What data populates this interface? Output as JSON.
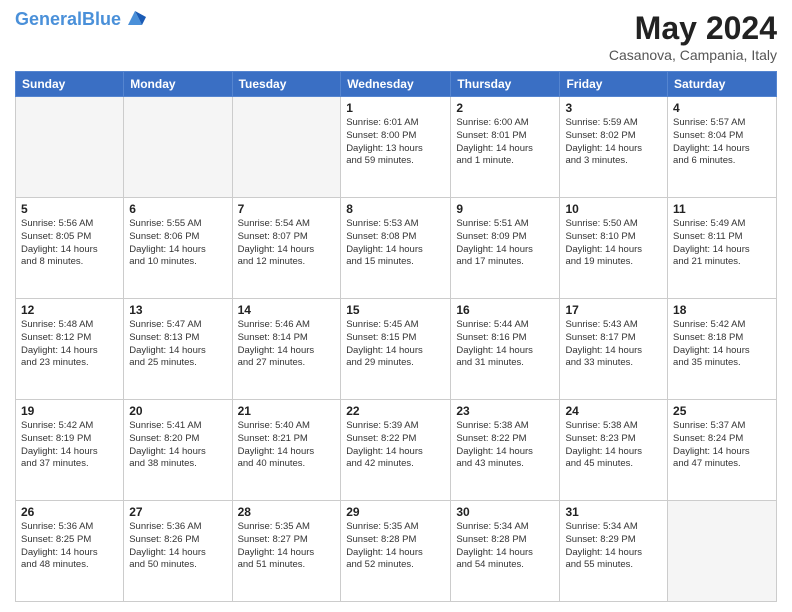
{
  "header": {
    "logo_line1": "General",
    "logo_line2": "Blue",
    "month": "May 2024",
    "location": "Casanova, Campania, Italy"
  },
  "days_of_week": [
    "Sunday",
    "Monday",
    "Tuesday",
    "Wednesday",
    "Thursday",
    "Friday",
    "Saturday"
  ],
  "weeks": [
    [
      {
        "day": "",
        "info": ""
      },
      {
        "day": "",
        "info": ""
      },
      {
        "day": "",
        "info": ""
      },
      {
        "day": "1",
        "info": "Sunrise: 6:01 AM\nSunset: 8:00 PM\nDaylight: 13 hours\nand 59 minutes."
      },
      {
        "day": "2",
        "info": "Sunrise: 6:00 AM\nSunset: 8:01 PM\nDaylight: 14 hours\nand 1 minute."
      },
      {
        "day": "3",
        "info": "Sunrise: 5:59 AM\nSunset: 8:02 PM\nDaylight: 14 hours\nand 3 minutes."
      },
      {
        "day": "4",
        "info": "Sunrise: 5:57 AM\nSunset: 8:04 PM\nDaylight: 14 hours\nand 6 minutes."
      }
    ],
    [
      {
        "day": "5",
        "info": "Sunrise: 5:56 AM\nSunset: 8:05 PM\nDaylight: 14 hours\nand 8 minutes."
      },
      {
        "day": "6",
        "info": "Sunrise: 5:55 AM\nSunset: 8:06 PM\nDaylight: 14 hours\nand 10 minutes."
      },
      {
        "day": "7",
        "info": "Sunrise: 5:54 AM\nSunset: 8:07 PM\nDaylight: 14 hours\nand 12 minutes."
      },
      {
        "day": "8",
        "info": "Sunrise: 5:53 AM\nSunset: 8:08 PM\nDaylight: 14 hours\nand 15 minutes."
      },
      {
        "day": "9",
        "info": "Sunrise: 5:51 AM\nSunset: 8:09 PM\nDaylight: 14 hours\nand 17 minutes."
      },
      {
        "day": "10",
        "info": "Sunrise: 5:50 AM\nSunset: 8:10 PM\nDaylight: 14 hours\nand 19 minutes."
      },
      {
        "day": "11",
        "info": "Sunrise: 5:49 AM\nSunset: 8:11 PM\nDaylight: 14 hours\nand 21 minutes."
      }
    ],
    [
      {
        "day": "12",
        "info": "Sunrise: 5:48 AM\nSunset: 8:12 PM\nDaylight: 14 hours\nand 23 minutes."
      },
      {
        "day": "13",
        "info": "Sunrise: 5:47 AM\nSunset: 8:13 PM\nDaylight: 14 hours\nand 25 minutes."
      },
      {
        "day": "14",
        "info": "Sunrise: 5:46 AM\nSunset: 8:14 PM\nDaylight: 14 hours\nand 27 minutes."
      },
      {
        "day": "15",
        "info": "Sunrise: 5:45 AM\nSunset: 8:15 PM\nDaylight: 14 hours\nand 29 minutes."
      },
      {
        "day": "16",
        "info": "Sunrise: 5:44 AM\nSunset: 8:16 PM\nDaylight: 14 hours\nand 31 minutes."
      },
      {
        "day": "17",
        "info": "Sunrise: 5:43 AM\nSunset: 8:17 PM\nDaylight: 14 hours\nand 33 minutes."
      },
      {
        "day": "18",
        "info": "Sunrise: 5:42 AM\nSunset: 8:18 PM\nDaylight: 14 hours\nand 35 minutes."
      }
    ],
    [
      {
        "day": "19",
        "info": "Sunrise: 5:42 AM\nSunset: 8:19 PM\nDaylight: 14 hours\nand 37 minutes."
      },
      {
        "day": "20",
        "info": "Sunrise: 5:41 AM\nSunset: 8:20 PM\nDaylight: 14 hours\nand 38 minutes."
      },
      {
        "day": "21",
        "info": "Sunrise: 5:40 AM\nSunset: 8:21 PM\nDaylight: 14 hours\nand 40 minutes."
      },
      {
        "day": "22",
        "info": "Sunrise: 5:39 AM\nSunset: 8:22 PM\nDaylight: 14 hours\nand 42 minutes."
      },
      {
        "day": "23",
        "info": "Sunrise: 5:38 AM\nSunset: 8:22 PM\nDaylight: 14 hours\nand 43 minutes."
      },
      {
        "day": "24",
        "info": "Sunrise: 5:38 AM\nSunset: 8:23 PM\nDaylight: 14 hours\nand 45 minutes."
      },
      {
        "day": "25",
        "info": "Sunrise: 5:37 AM\nSunset: 8:24 PM\nDaylight: 14 hours\nand 47 minutes."
      }
    ],
    [
      {
        "day": "26",
        "info": "Sunrise: 5:36 AM\nSunset: 8:25 PM\nDaylight: 14 hours\nand 48 minutes."
      },
      {
        "day": "27",
        "info": "Sunrise: 5:36 AM\nSunset: 8:26 PM\nDaylight: 14 hours\nand 50 minutes."
      },
      {
        "day": "28",
        "info": "Sunrise: 5:35 AM\nSunset: 8:27 PM\nDaylight: 14 hours\nand 51 minutes."
      },
      {
        "day": "29",
        "info": "Sunrise: 5:35 AM\nSunset: 8:28 PM\nDaylight: 14 hours\nand 52 minutes."
      },
      {
        "day": "30",
        "info": "Sunrise: 5:34 AM\nSunset: 8:28 PM\nDaylight: 14 hours\nand 54 minutes."
      },
      {
        "day": "31",
        "info": "Sunrise: 5:34 AM\nSunset: 8:29 PM\nDaylight: 14 hours\nand 55 minutes."
      },
      {
        "day": "",
        "info": ""
      }
    ]
  ]
}
